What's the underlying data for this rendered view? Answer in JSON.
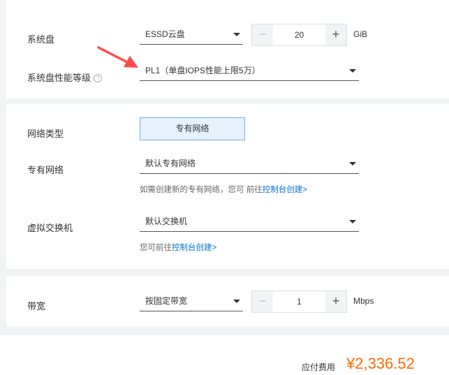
{
  "system_disk": {
    "label": "系统盘",
    "type_value": "ESSD云盘",
    "size_value": "20",
    "size_unit": "GiB",
    "minus": "−",
    "plus": "+",
    "performance_label": "系统盘性能等级",
    "performance_help": "?",
    "performance_value": "PL1（单盘IOPS性能上限5万）"
  },
  "network": {
    "type_label": "网络类型",
    "type_tile": "专有网络",
    "vpc_label": "专有网络",
    "vpc_value": "默认专有网络",
    "vpc_hint_prefix": "如需创建新的专有网络，您可 前往",
    "vpc_hint_link": "控制台创建>",
    "vswitch_label": "虚拟交换机",
    "vswitch_value": "默认交换机",
    "vswitch_hint_prefix": "您可前往",
    "vswitch_hint_link": "控制台创建>"
  },
  "bandwidth": {
    "label": "带宽",
    "mode_value": "按固定带宽",
    "amount_value": "1",
    "amount_unit": "Mbps",
    "minus": "−",
    "plus": "+"
  },
  "footer": {
    "fee_label": "应付费用",
    "fee_value": "¥2,336.52"
  },
  "colors": {
    "accent_link": "#0070cc",
    "price": "#ff6a00",
    "tile_bg": "#e6f1fb",
    "tile_border": "#6fb0e8",
    "annotation_arrow": "#ff4a4a"
  }
}
